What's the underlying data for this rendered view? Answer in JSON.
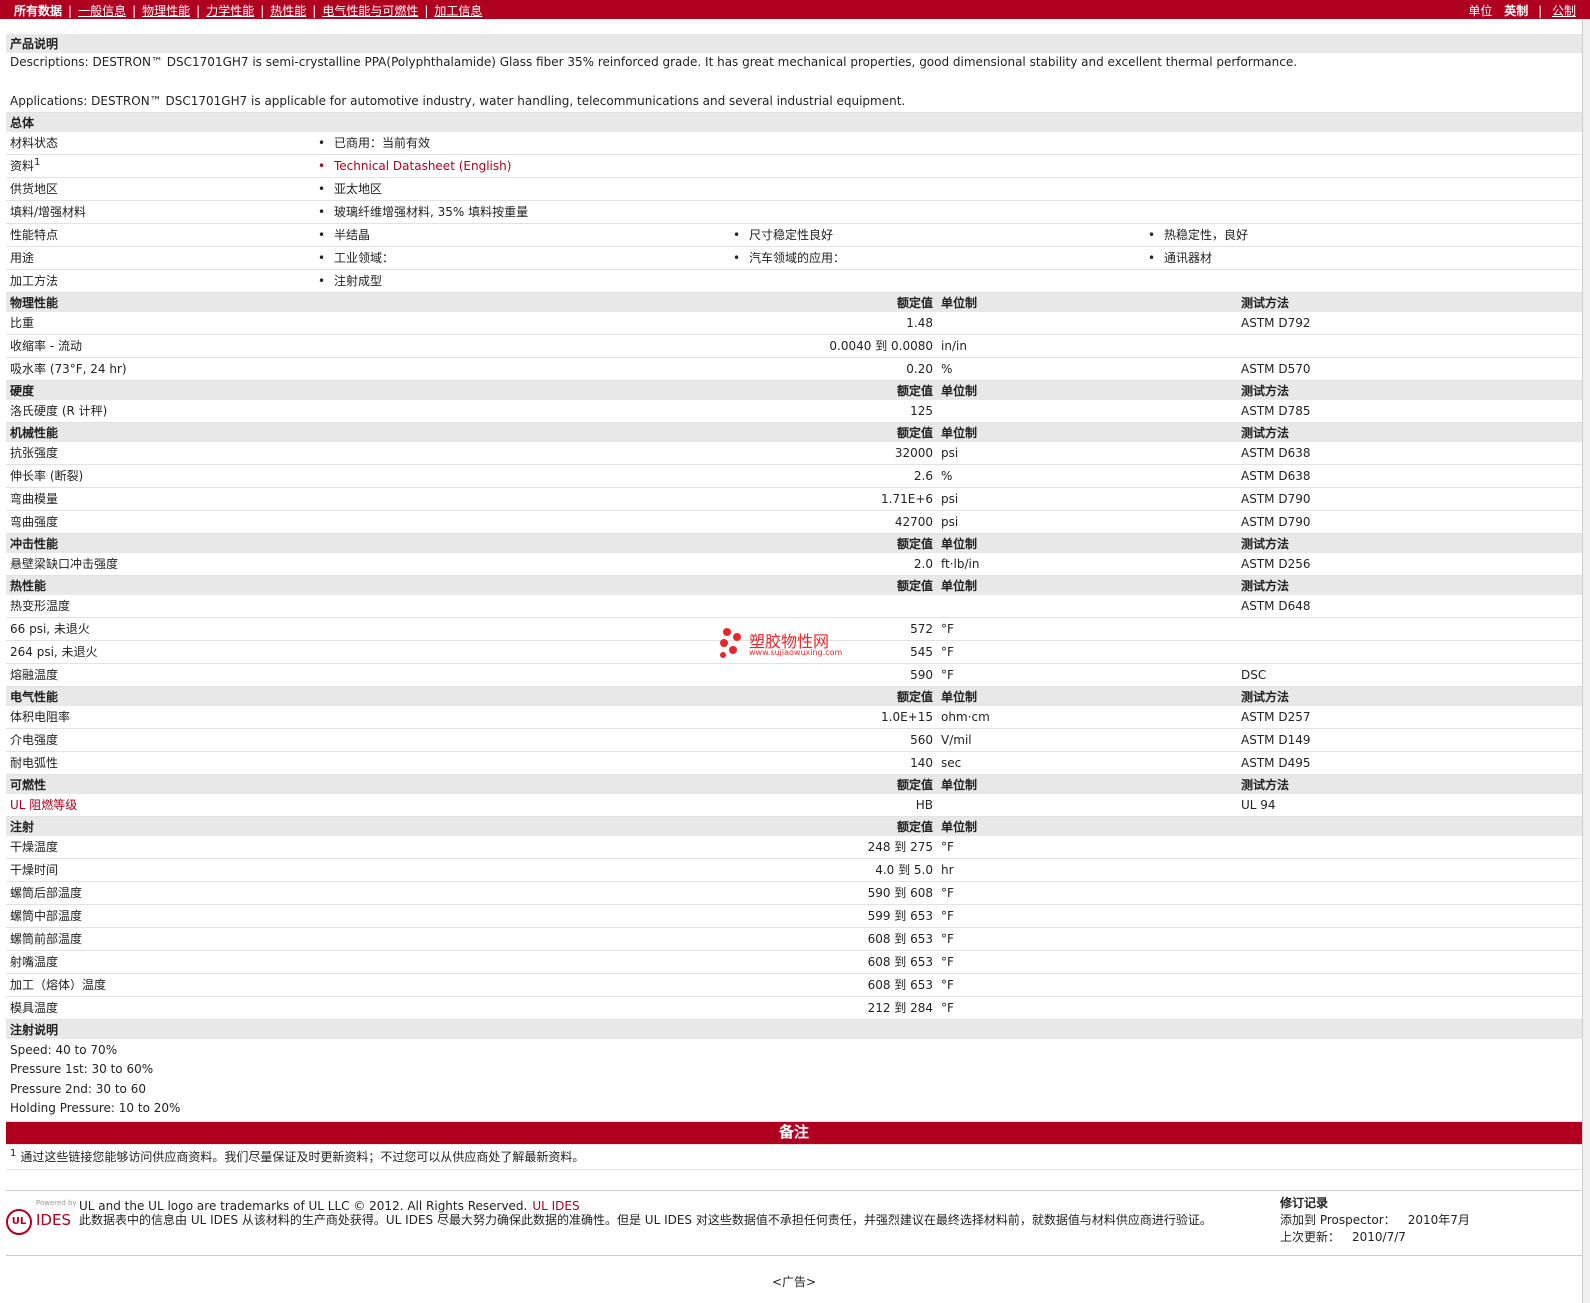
{
  "nav": {
    "tabs": [
      "所有数据",
      "一般信息",
      "物理性能",
      "力学性能",
      "热性能",
      "电气性能与可燃性",
      "加工信息"
    ],
    "unit_label": "单位",
    "unit_active": "英制",
    "unit_other": "公制"
  },
  "desc": {
    "heading": "产品说明",
    "line1": "Descriptions: DESTRON™ DSC1701GH7 is semi-crystalline PPA(Polyphthalamide) Glass fiber 35% reinforced grade. It has great mechanical properties, good dimensional stability and excellent thermal performance.",
    "line2": "Applications: DESTRON™ DSC1701GH7 is applicable for automotive industry, water handling, telecommunications and several industrial equipment."
  },
  "general": {
    "heading": "总体",
    "rows": [
      {
        "label": "材料状态",
        "values": [
          "已商用：当前有效"
        ]
      },
      {
        "label": "资料",
        "sup": "1",
        "values": [
          "Technical Datasheet (English)"
        ]
      },
      {
        "label": "供货地区",
        "values": [
          "亚太地区"
        ]
      },
      {
        "label": "填料/增强材料",
        "values": [
          "玻璃纤维增强材料, 35% 填料按重量"
        ]
      },
      {
        "label": "性能特点",
        "values": [
          "半结晶",
          "尺寸稳定性良好",
          "热稳定性，良好"
        ]
      },
      {
        "label": "用途",
        "values": [
          "工业领域：",
          "汽车领域的应用：",
          "通讯器材"
        ]
      },
      {
        "label": "加工方法",
        "values": [
          "注射成型"
        ]
      }
    ]
  },
  "cols": {
    "nominal": "额定值",
    "unit": "单位制",
    "method": "测试方法"
  },
  "sections": [
    {
      "title": "物理性能",
      "method_header": true,
      "rows": [
        {
          "label": "比重",
          "value": "1.48",
          "unit": "",
          "method": "ASTM D792"
        },
        {
          "label": "收缩率  - 流动",
          "value": "0.0040 到  0.0080",
          "unit": "in/in",
          "method": ""
        },
        {
          "label": "吸水率  (73°F, 24 hr)",
          "value": "0.20",
          "unit": "%",
          "method": "ASTM D570"
        }
      ]
    },
    {
      "title": "硬度",
      "method_header": true,
      "rows": [
        {
          "label": "洛氏硬度  (R 计秤)",
          "value": "125",
          "unit": "",
          "method": "ASTM D785"
        }
      ]
    },
    {
      "title": "机械性能",
      "method_header": true,
      "rows": [
        {
          "label": "抗张强度",
          "value": "32000",
          "unit": "psi",
          "method": "ASTM D638"
        },
        {
          "label": "伸长率  (断裂)",
          "value": "2.6",
          "unit": "%",
          "method": "ASTM D638"
        },
        {
          "label": "弯曲模量",
          "value": "1.71E+6",
          "unit": "psi",
          "method": "ASTM D790"
        },
        {
          "label": "弯曲强度",
          "value": "42700",
          "unit": "psi",
          "method": "ASTM D790"
        }
      ]
    },
    {
      "title": "冲击性能",
      "method_header": true,
      "rows": [
        {
          "label": "悬壁梁缺口冲击强度",
          "value": "2.0",
          "unit": "ft·lb/in",
          "method": "ASTM D256"
        }
      ]
    },
    {
      "title": "热性能",
      "method_header": true,
      "rows": [
        {
          "label": "热变形温度",
          "value": "",
          "unit": "",
          "method": "ASTM D648"
        },
        {
          "label": "66 psi, 未退火",
          "value": "572",
          "unit": "°F",
          "method": "",
          "indent": true
        },
        {
          "label": "264 psi, 未退火",
          "value": "545",
          "unit": "°F",
          "method": "",
          "indent": true
        },
        {
          "label": "熔融温度",
          "value": "590",
          "unit": "°F",
          "method": "DSC"
        }
      ]
    },
    {
      "title": "电气性能",
      "method_header": true,
      "rows": [
        {
          "label": "体积电阻率",
          "value": "1.0E+15",
          "unit": "ohm·cm",
          "method": "ASTM D257"
        },
        {
          "label": "介电强度",
          "value": "560",
          "unit": "V/mil",
          "method": "ASTM D149"
        },
        {
          "label": "耐电弧性",
          "value": "140",
          "unit": "sec",
          "method": "ASTM D495"
        }
      ]
    },
    {
      "title": "可燃性",
      "method_header": true,
      "rows": [
        {
          "label": "UL 阻燃等级",
          "value": "HB",
          "unit": "",
          "method": "UL 94",
          "link": true
        }
      ]
    },
    {
      "title": "注射",
      "method_header": false,
      "rows": [
        {
          "label": "干燥温度",
          "value": "248 到  275",
          "unit": "°F",
          "method": ""
        },
        {
          "label": "干燥时间",
          "value": "4.0 到  5.0",
          "unit": "hr",
          "method": ""
        },
        {
          "label": "螺筒后部温度",
          "value": "590 到  608",
          "unit": "°F",
          "method": ""
        },
        {
          "label": "螺筒中部温度",
          "value": "599 到  653",
          "unit": "°F",
          "method": ""
        },
        {
          "label": "螺筒前部温度",
          "value": "608 到  653",
          "unit": "°F",
          "method": ""
        },
        {
          "label": "射嘴温度",
          "value": "608 到  653",
          "unit": "°F",
          "method": ""
        },
        {
          "label": "加工（熔体）温度",
          "value": "608 到  653",
          "unit": "°F",
          "method": ""
        },
        {
          "label": "模具温度",
          "value": "212 到  284",
          "unit": "°F",
          "method": ""
        }
      ]
    }
  ],
  "injection_notes": {
    "heading": "注射说明",
    "lines": [
      "Speed: 40 to 70%",
      "Pressure 1st: 30 to 60%",
      "Pressure 2nd: 30 to 60",
      "Holding Pressure: 10 to 20%"
    ]
  },
  "remarks": {
    "heading": "备注",
    "sup": "1",
    "text": "通过这些链接您能够访问供应商资料。我们尽量保证及时更新资料；不过您可以从供应商处了解最新资料。"
  },
  "footer": {
    "powered_by": "Powered by",
    "logo_ul": "UL",
    "logo_ides": "IDES",
    "trademark": "UL and the UL logo are trademarks of UL LLC © 2012. All Rights Reserved.",
    "trademark_link": "UL IDES",
    "disclaimer": "此数据表中的信息由  UL IDES 从该材料的生产商处获得。UL IDES 尽最大努力确保此数据的准确性。但是  UL IDES 对这些数据值不承担任何责任，并强烈建议在最终选择材料前，就数据值与材料供应商进行验证。",
    "rev_title": "修订记录",
    "added_label": "添加到  Prospector：",
    "added_value": "2010年7月",
    "updated_label": "上次更新：",
    "updated_value": "2010/7/7"
  },
  "watermark": {
    "title": "塑胶物性网",
    "url": "www.sujiaowuxing.com"
  },
  "ad": "<广告>"
}
